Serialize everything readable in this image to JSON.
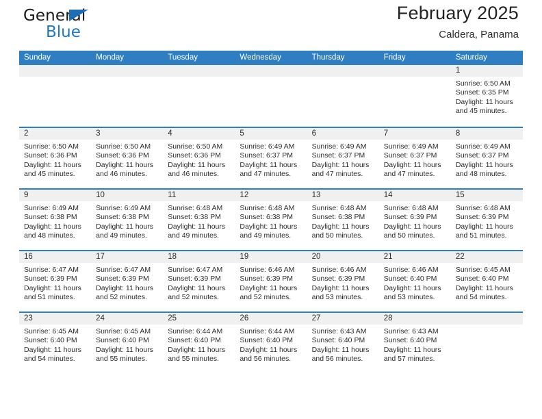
{
  "brand": {
    "name_top": "General",
    "name_bottom": "Blue",
    "triangle_color": "#1f6db5",
    "text_color": "#1f78c1"
  },
  "header": {
    "title": "February 2025",
    "subtitle": "Caldera, Panama"
  },
  "theme": {
    "header_blue": "#2f7ec1",
    "band_gray": "#f0f0f0"
  },
  "weekdays": [
    "Sunday",
    "Monday",
    "Tuesday",
    "Wednesday",
    "Thursday",
    "Friday",
    "Saturday"
  ],
  "weeks": [
    [
      {
        "day": "",
        "sunrise": "",
        "sunset": "",
        "daylight_line1": "",
        "daylight_line2": ""
      },
      {
        "day": "",
        "sunrise": "",
        "sunset": "",
        "daylight_line1": "",
        "daylight_line2": ""
      },
      {
        "day": "",
        "sunrise": "",
        "sunset": "",
        "daylight_line1": "",
        "daylight_line2": ""
      },
      {
        "day": "",
        "sunrise": "",
        "sunset": "",
        "daylight_line1": "",
        "daylight_line2": ""
      },
      {
        "day": "",
        "sunrise": "",
        "sunset": "",
        "daylight_line1": "",
        "daylight_line2": ""
      },
      {
        "day": "",
        "sunrise": "",
        "sunset": "",
        "daylight_line1": "",
        "daylight_line2": ""
      },
      {
        "day": "1",
        "sunrise": "Sunrise: 6:50 AM",
        "sunset": "Sunset: 6:35 PM",
        "daylight_line1": "Daylight: 11 hours",
        "daylight_line2": "and 45 minutes."
      }
    ],
    [
      {
        "day": "2",
        "sunrise": "Sunrise: 6:50 AM",
        "sunset": "Sunset: 6:36 PM",
        "daylight_line1": "Daylight: 11 hours",
        "daylight_line2": "and 45 minutes."
      },
      {
        "day": "3",
        "sunrise": "Sunrise: 6:50 AM",
        "sunset": "Sunset: 6:36 PM",
        "daylight_line1": "Daylight: 11 hours",
        "daylight_line2": "and 46 minutes."
      },
      {
        "day": "4",
        "sunrise": "Sunrise: 6:50 AM",
        "sunset": "Sunset: 6:36 PM",
        "daylight_line1": "Daylight: 11 hours",
        "daylight_line2": "and 46 minutes."
      },
      {
        "day": "5",
        "sunrise": "Sunrise: 6:49 AM",
        "sunset": "Sunset: 6:37 PM",
        "daylight_line1": "Daylight: 11 hours",
        "daylight_line2": "and 47 minutes."
      },
      {
        "day": "6",
        "sunrise": "Sunrise: 6:49 AM",
        "sunset": "Sunset: 6:37 PM",
        "daylight_line1": "Daylight: 11 hours",
        "daylight_line2": "and 47 minutes."
      },
      {
        "day": "7",
        "sunrise": "Sunrise: 6:49 AM",
        "sunset": "Sunset: 6:37 PM",
        "daylight_line1": "Daylight: 11 hours",
        "daylight_line2": "and 47 minutes."
      },
      {
        "day": "8",
        "sunrise": "Sunrise: 6:49 AM",
        "sunset": "Sunset: 6:37 PM",
        "daylight_line1": "Daylight: 11 hours",
        "daylight_line2": "and 48 minutes."
      }
    ],
    [
      {
        "day": "9",
        "sunrise": "Sunrise: 6:49 AM",
        "sunset": "Sunset: 6:38 PM",
        "daylight_line1": "Daylight: 11 hours",
        "daylight_line2": "and 48 minutes."
      },
      {
        "day": "10",
        "sunrise": "Sunrise: 6:49 AM",
        "sunset": "Sunset: 6:38 PM",
        "daylight_line1": "Daylight: 11 hours",
        "daylight_line2": "and 49 minutes."
      },
      {
        "day": "11",
        "sunrise": "Sunrise: 6:48 AM",
        "sunset": "Sunset: 6:38 PM",
        "daylight_line1": "Daylight: 11 hours",
        "daylight_line2": "and 49 minutes."
      },
      {
        "day": "12",
        "sunrise": "Sunrise: 6:48 AM",
        "sunset": "Sunset: 6:38 PM",
        "daylight_line1": "Daylight: 11 hours",
        "daylight_line2": "and 49 minutes."
      },
      {
        "day": "13",
        "sunrise": "Sunrise: 6:48 AM",
        "sunset": "Sunset: 6:38 PM",
        "daylight_line1": "Daylight: 11 hours",
        "daylight_line2": "and 50 minutes."
      },
      {
        "day": "14",
        "sunrise": "Sunrise: 6:48 AM",
        "sunset": "Sunset: 6:39 PM",
        "daylight_line1": "Daylight: 11 hours",
        "daylight_line2": "and 50 minutes."
      },
      {
        "day": "15",
        "sunrise": "Sunrise: 6:48 AM",
        "sunset": "Sunset: 6:39 PM",
        "daylight_line1": "Daylight: 11 hours",
        "daylight_line2": "and 51 minutes."
      }
    ],
    [
      {
        "day": "16",
        "sunrise": "Sunrise: 6:47 AM",
        "sunset": "Sunset: 6:39 PM",
        "daylight_line1": "Daylight: 11 hours",
        "daylight_line2": "and 51 minutes."
      },
      {
        "day": "17",
        "sunrise": "Sunrise: 6:47 AM",
        "sunset": "Sunset: 6:39 PM",
        "daylight_line1": "Daylight: 11 hours",
        "daylight_line2": "and 52 minutes."
      },
      {
        "day": "18",
        "sunrise": "Sunrise: 6:47 AM",
        "sunset": "Sunset: 6:39 PM",
        "daylight_line1": "Daylight: 11 hours",
        "daylight_line2": "and 52 minutes."
      },
      {
        "day": "19",
        "sunrise": "Sunrise: 6:46 AM",
        "sunset": "Sunset: 6:39 PM",
        "daylight_line1": "Daylight: 11 hours",
        "daylight_line2": "and 52 minutes."
      },
      {
        "day": "20",
        "sunrise": "Sunrise: 6:46 AM",
        "sunset": "Sunset: 6:39 PM",
        "daylight_line1": "Daylight: 11 hours",
        "daylight_line2": "and 53 minutes."
      },
      {
        "day": "21",
        "sunrise": "Sunrise: 6:46 AM",
        "sunset": "Sunset: 6:40 PM",
        "daylight_line1": "Daylight: 11 hours",
        "daylight_line2": "and 53 minutes."
      },
      {
        "day": "22",
        "sunrise": "Sunrise: 6:45 AM",
        "sunset": "Sunset: 6:40 PM",
        "daylight_line1": "Daylight: 11 hours",
        "daylight_line2": "and 54 minutes."
      }
    ],
    [
      {
        "day": "23",
        "sunrise": "Sunrise: 6:45 AM",
        "sunset": "Sunset: 6:40 PM",
        "daylight_line1": "Daylight: 11 hours",
        "daylight_line2": "and 54 minutes."
      },
      {
        "day": "24",
        "sunrise": "Sunrise: 6:45 AM",
        "sunset": "Sunset: 6:40 PM",
        "daylight_line1": "Daylight: 11 hours",
        "daylight_line2": "and 55 minutes."
      },
      {
        "day": "25",
        "sunrise": "Sunrise: 6:44 AM",
        "sunset": "Sunset: 6:40 PM",
        "daylight_line1": "Daylight: 11 hours",
        "daylight_line2": "and 55 minutes."
      },
      {
        "day": "26",
        "sunrise": "Sunrise: 6:44 AM",
        "sunset": "Sunset: 6:40 PM",
        "daylight_line1": "Daylight: 11 hours",
        "daylight_line2": "and 56 minutes."
      },
      {
        "day": "27",
        "sunrise": "Sunrise: 6:43 AM",
        "sunset": "Sunset: 6:40 PM",
        "daylight_line1": "Daylight: 11 hours",
        "daylight_line2": "and 56 minutes."
      },
      {
        "day": "28",
        "sunrise": "Sunrise: 6:43 AM",
        "sunset": "Sunset: 6:40 PM",
        "daylight_line1": "Daylight: 11 hours",
        "daylight_line2": "and 57 minutes."
      },
      {
        "day": "",
        "sunrise": "",
        "sunset": "",
        "daylight_line1": "",
        "daylight_line2": ""
      }
    ]
  ]
}
